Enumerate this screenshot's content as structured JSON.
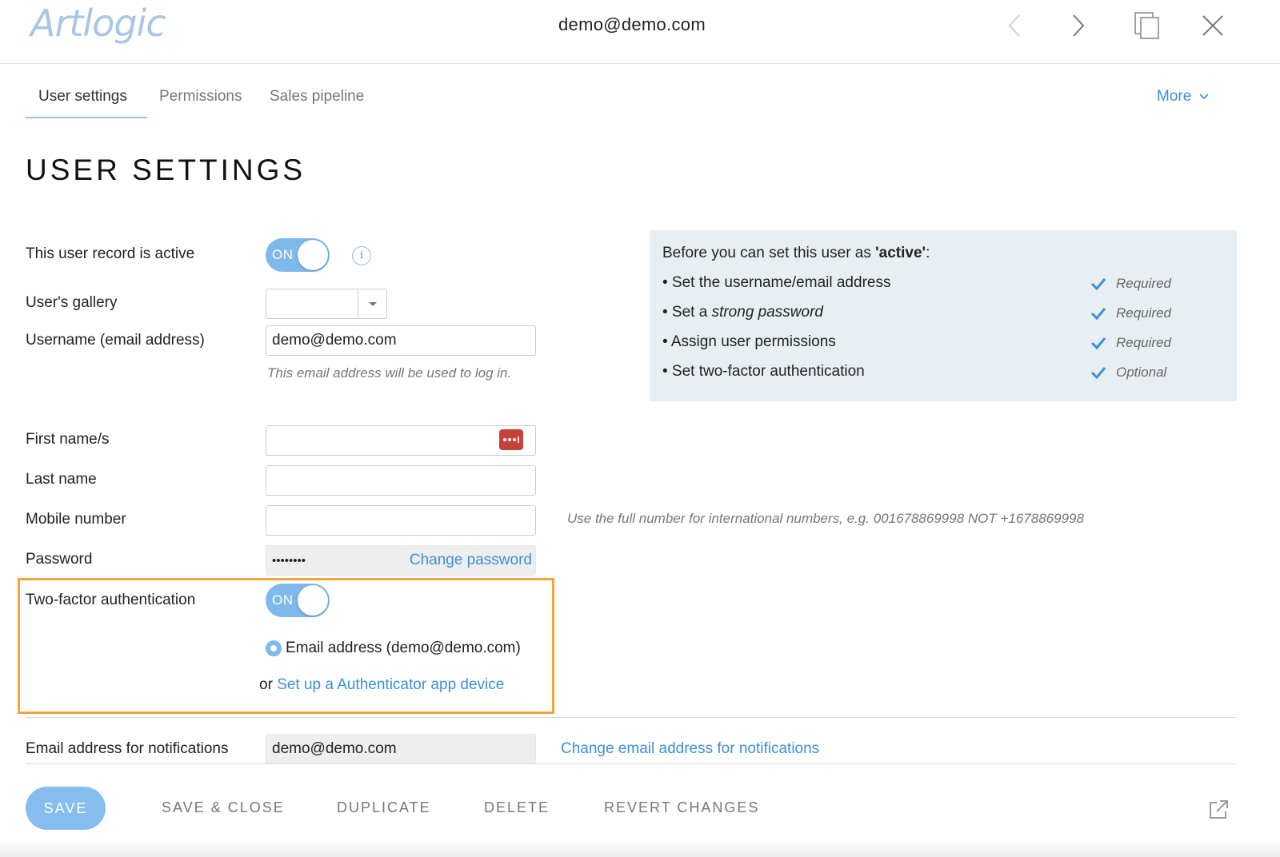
{
  "header": {
    "logo": "Artlogic",
    "title": "demo@demo.com",
    "icons": {
      "back": "chevron-left-icon",
      "forward": "chevron-right-icon",
      "duplicate": "copy-icon",
      "close": "close-icon"
    }
  },
  "tabs": [
    {
      "label": "User settings",
      "active": true
    },
    {
      "label": "Permissions",
      "active": false
    },
    {
      "label": "Sales pipeline",
      "active": false
    }
  ],
  "more_label": "More",
  "page_title": "USER SETTINGS",
  "form": {
    "active_label": "This user record is active",
    "active_toggle": "ON",
    "gallery_label": "User's gallery",
    "gallery_value": "",
    "username_label": "Username (email address)",
    "username_value": "demo@demo.com",
    "username_hint": "This email address will be used to log in.",
    "first_name_label": "First name/s",
    "first_name_value": "",
    "last_name_label": "Last name",
    "last_name_value": "",
    "mobile_label": "Mobile number",
    "mobile_value": "",
    "mobile_hint": "Use the full number for international numbers, e.g. 001678869998 NOT +1678869998",
    "password_label": "Password",
    "password_value": "••••••••",
    "change_password": "Change password",
    "twofa_label": "Two-factor authentication",
    "twofa_toggle": "ON",
    "twofa_option": "Email address (demo@demo.com)",
    "twofa_or": "or",
    "twofa_app_link": "Set up a Authenticator app device",
    "notify_label": "Email address for notifications",
    "notify_value": "demo@demo.com",
    "notify_change_link": "Change email address for notifications"
  },
  "requirements": {
    "intro": "Before you can set this user as ",
    "intro_bold": "'active'",
    "intro_end": ":",
    "items": [
      {
        "prefix": "• Set the username/email address",
        "emph": "",
        "status": "Required"
      },
      {
        "prefix": "• Set a ",
        "emph": "strong password",
        "status": "Required"
      },
      {
        "prefix": "• Assign user permissions",
        "emph": "",
        "status": "Required"
      },
      {
        "prefix": "• Set two-factor authentication",
        "emph": "",
        "status": "Optional"
      }
    ]
  },
  "footer": {
    "save": "SAVE",
    "save_close": "SAVE & CLOSE",
    "duplicate": "DUPLICATE",
    "delete": "DELETE",
    "revert": "REVERT CHANGES"
  },
  "colors": {
    "accent": "#3d8fdb",
    "toggle": "#7fb8ea",
    "highlight": "#f3a43d",
    "panel": "#e8eff3",
    "lastpass": "#c6413a"
  }
}
